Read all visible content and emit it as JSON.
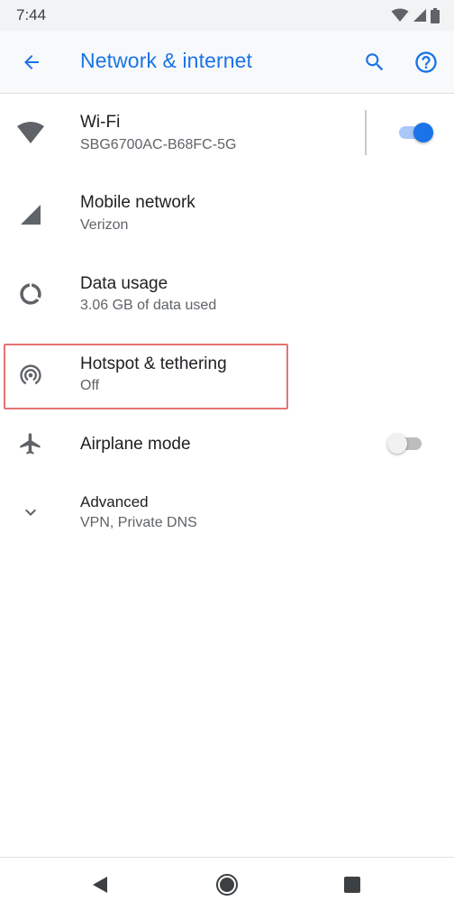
{
  "status_bar": {
    "time": "7:44",
    "icons": [
      "wifi-icon",
      "signal-icon",
      "battery-icon"
    ]
  },
  "app_bar": {
    "title": "Network & internet",
    "icons": [
      "back-arrow-icon",
      "search-icon",
      "help-icon"
    ],
    "accent_color": "#1a73e8"
  },
  "settings": {
    "wifi": {
      "title": "Wi-Fi",
      "subtitle": "SBG6700AC-B68FC-5G",
      "toggle_on": true,
      "icon": "wifi-icon"
    },
    "mobile_network": {
      "title": "Mobile network",
      "subtitle": "Verizon",
      "icon": "signal-icon"
    },
    "data_usage": {
      "title": "Data usage",
      "subtitle": "3.06 GB of data used",
      "icon": "data-usage-icon"
    },
    "hotspot": {
      "title": "Hotspot & tethering",
      "subtitle": "Off",
      "icon": "hotspot-icon",
      "highlighted": true
    },
    "airplane": {
      "title": "Airplane mode",
      "toggle_on": false,
      "icon": "airplane-icon"
    },
    "advanced": {
      "title": "Advanced",
      "subtitle": "VPN, Private DNS",
      "icon": "chevron-down-icon"
    }
  },
  "nav_bar": {
    "icons": [
      "back-triangle-icon",
      "home-circle-icon",
      "recents-square-icon"
    ]
  }
}
